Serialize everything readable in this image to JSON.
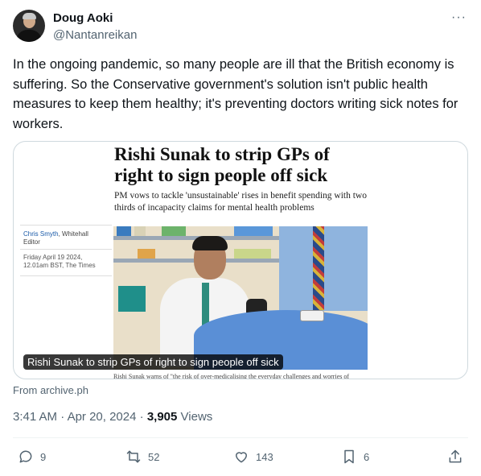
{
  "author": {
    "display_name": "Doug Aoki",
    "handle": "@Nantanreikan",
    "avatar_icon": "avatar"
  },
  "more_label": "···",
  "tweet": {
    "text": "In the ongoing pandemic, so many people are ill that the British economy is suffering. So the Conservative government's solution isn't public health measures to keep them healthy; it's preventing doctors writing sick notes for workers."
  },
  "card": {
    "headline": "Rishi Sunak to strip GPs of right to sign people off sick",
    "subhead": "PM vows to tackle 'unsustainable' rises in benefit spending with two thirds of incapacity claims for mental health problems",
    "author_name": "Chris Smyth",
    "author_role_line1": ", Whitehall",
    "author_role_line2": "Editor",
    "date_line1": "Friday April 19 2024,",
    "date_line2": "12.01am BST, The Times",
    "caption": "Rishi Sunak to strip GPs of right to sign people off sick",
    "body_snippet": "Rishi Sunak warns of \"the risk of over-medicalising the everyday challenges and worries of",
    "source": "From archive.ph"
  },
  "meta": {
    "time": "3:41 AM",
    "separator": " · ",
    "date": "Apr 20, 2024",
    "views_count": "3,905",
    "views_label": "Views"
  },
  "actions": {
    "replies": "9",
    "reposts": "52",
    "likes": "143",
    "bookmarks": "6"
  },
  "colors": {
    "text_primary": "#0f1419",
    "text_secondary": "#536471",
    "border": "#cfd9de",
    "divider": "#eff3f4"
  }
}
